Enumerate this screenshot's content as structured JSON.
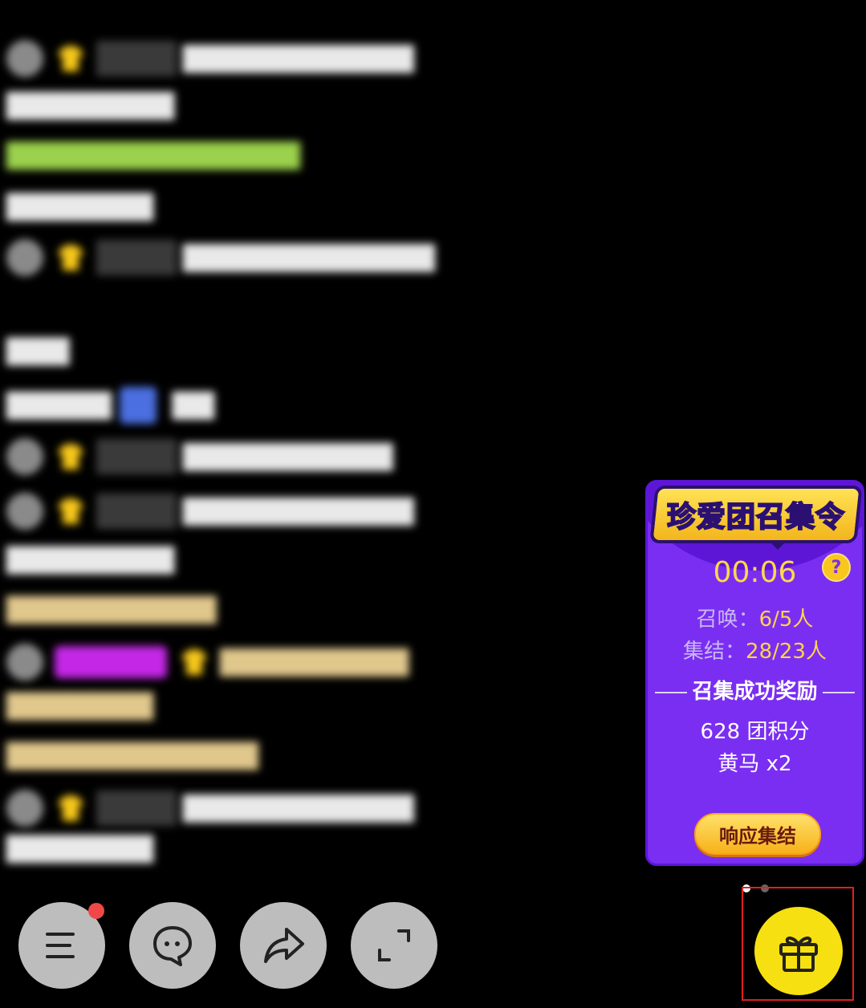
{
  "rally_card": {
    "title": "珍爱团召集令",
    "timer": "00:06",
    "summon_label": "召唤：",
    "summon_value": "6/5人",
    "gather_label": "集结：",
    "gather_value": "28/23人",
    "reward_title": "召集成功奖励",
    "rewards": [
      "628 团积分",
      "黄马 x2"
    ],
    "respond_button": "响应集结",
    "help_glyph": "?",
    "colors": {
      "card": "#7a2ef2",
      "accent": "#ffd34a",
      "button": "#f7b21a"
    }
  },
  "controls": {
    "menu_icon": "menu-icon",
    "chat_icon": "chat-bubble-icon",
    "share_icon": "share-arrow-icon",
    "fullscreen_icon": "fullscreen-icon",
    "gift_icon": "gift-icon",
    "gift_color": "#f7e011"
  },
  "pager": {
    "total": 2,
    "active": 0
  }
}
